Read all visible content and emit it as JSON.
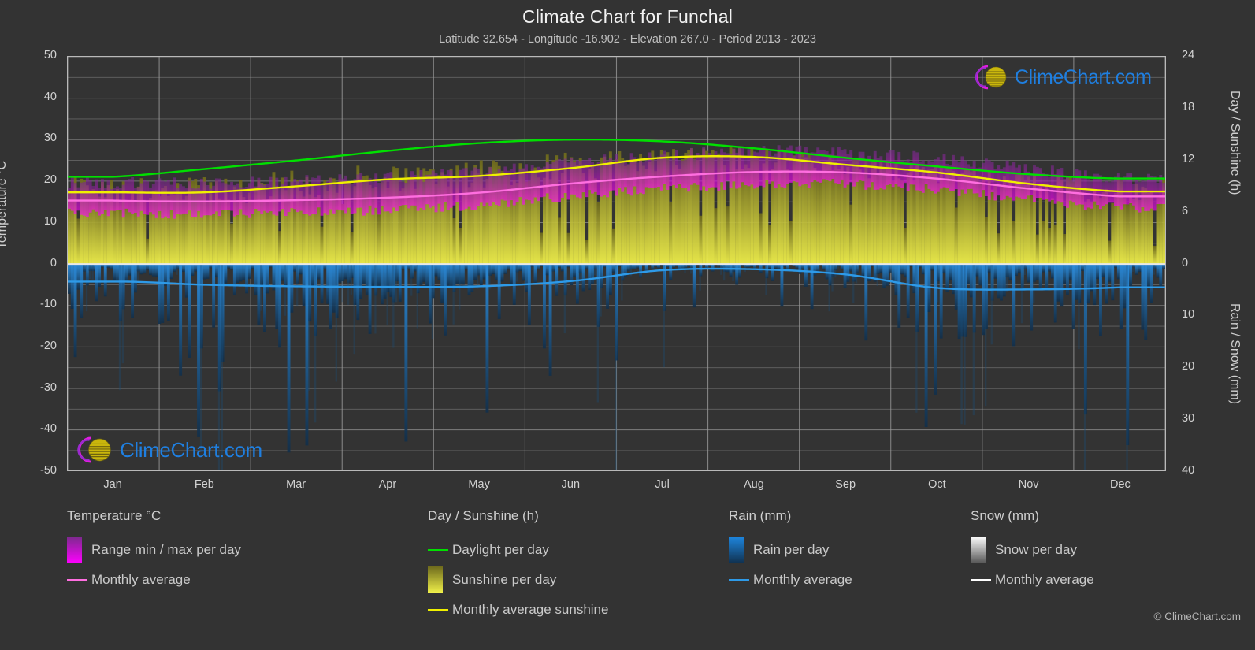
{
  "header": {
    "title": "Climate Chart for Funchal",
    "subtitle": "Latitude 32.654 - Longitude -16.902 - Elevation 267.0 - Period 2013 - 2023"
  },
  "logo": {
    "text": "ClimeChart.com",
    "mark_name": "climechart-logo-icon"
  },
  "copyright": "© ClimeChart.com",
  "axes": {
    "left_title": "Temperature °C",
    "right_top_title": "Day / Sunshine (h)",
    "right_bottom_title": "Rain / Snow (mm)",
    "left_ticks": [
      "50",
      "40",
      "30",
      "20",
      "10",
      "0",
      "-10",
      "-20",
      "-30",
      "-40",
      "-50"
    ],
    "right_ticks": [
      "24",
      "18",
      "12",
      "6",
      "0",
      "10",
      "20",
      "30",
      "40"
    ],
    "months": [
      "Jan",
      "Feb",
      "Mar",
      "Apr",
      "May",
      "Jun",
      "Jul",
      "Aug",
      "Sep",
      "Oct",
      "Nov",
      "Dec"
    ]
  },
  "colors": {
    "background": "#333333",
    "grid": "#7d7d7d",
    "frame": "#b9b9b9",
    "temp_range_top": "#7b2a8c",
    "temp_range_bottom": "#ff00ff",
    "temp_avg_line": "#ff6ee0",
    "daylight_line": "#00e000",
    "sunshine_fill_top": "#6e6a1c",
    "sunshine_fill_bottom": "#f2f24a",
    "sunshine_avg_line": "#f0f000",
    "rain_fill_top": "#1e87e0",
    "rain_fill_bottom": "#10304e",
    "rain_avg_line": "#2e9ae8",
    "snow_fill_top": "#ffffff",
    "snow_fill_bottom": "#555555",
    "snow_avg_line": "#ffffff"
  },
  "legend": {
    "temperature": {
      "title": "Temperature °C",
      "items": [
        {
          "label": "Range min / max per day",
          "swatch": "gradient",
          "color_top": "#7b2a8c",
          "color_bottom": "#ff00ff"
        },
        {
          "label": "Monthly average",
          "swatch": "line",
          "color": "#ff6ee0"
        }
      ]
    },
    "day_sunshine": {
      "title": "Day / Sunshine (h)",
      "items": [
        {
          "label": "Daylight per day",
          "swatch": "line",
          "color": "#00e000"
        },
        {
          "label": "Sunshine per day",
          "swatch": "gradient",
          "color_top": "#6e6a1c",
          "color_bottom": "#f2f24a"
        },
        {
          "label": "Monthly average sunshine",
          "swatch": "line",
          "color": "#f0f000"
        }
      ]
    },
    "rain": {
      "title": "Rain (mm)",
      "items": [
        {
          "label": "Rain per day",
          "swatch": "gradient",
          "color_top": "#1e87e0",
          "color_bottom": "#10304e"
        },
        {
          "label": "Monthly average",
          "swatch": "line",
          "color": "#2e9ae8"
        }
      ]
    },
    "snow": {
      "title": "Snow (mm)",
      "items": [
        {
          "label": "Snow per day",
          "swatch": "gradient",
          "color_top": "#ffffff",
          "color_bottom": "#555555"
        },
        {
          "label": "Monthly average",
          "swatch": "line",
          "color": "#ffffff"
        }
      ]
    }
  },
  "chart_data": {
    "type": "line",
    "title": "Climate Chart for Funchal",
    "subtitle": "Latitude 32.654 - Longitude -16.902 - Elevation 267.0 - Period 2013 - 2023",
    "xlabel": "",
    "ylabel": "Temperature °C",
    "ylabel_right_top": "Day / Sunshine (h)",
    "ylabel_right_bottom": "Rain / Snow (mm)",
    "ylim": [
      -50,
      50
    ],
    "ylim_right_sunshine": [
      0,
      24
    ],
    "ylim_right_rain": [
      0,
      40
    ],
    "grid": true,
    "legend_position": "below-chart",
    "categories": [
      "Jan",
      "Feb",
      "Mar",
      "Apr",
      "May",
      "Jun",
      "Jul",
      "Aug",
      "Sep",
      "Oct",
      "Nov",
      "Dec"
    ],
    "series": [
      {
        "name": "Monthly average temperature",
        "unit": "°C",
        "axis": "left",
        "color": "#ff6ee0",
        "values": [
          15.3,
          15.1,
          15.4,
          16.0,
          17.2,
          19.4,
          21.1,
          22.2,
          22.1,
          20.6,
          18.2,
          16.3
        ]
      },
      {
        "name": "Daily temperature range max",
        "unit": "°C",
        "axis": "left",
        "color": "#7b2a8c",
        "values": [
          19.6,
          19.4,
          20.0,
          20.8,
          22.1,
          24.3,
          26.1,
          27.2,
          26.9,
          25.4,
          22.9,
          20.7
        ]
      },
      {
        "name": "Daily temperature range min",
        "unit": "°C",
        "axis": "left",
        "color": "#ff00ff",
        "values": [
          12.4,
          12.1,
          12.4,
          13.1,
          14.3,
          16.4,
          18.1,
          19.2,
          19.3,
          17.9,
          15.6,
          13.6
        ]
      },
      {
        "name": "Daylight per day",
        "unit": "h",
        "axis": "right_top",
        "color": "#00e000",
        "values": [
          10.1,
          11.0,
          12.0,
          13.1,
          14.0,
          14.4,
          14.2,
          13.4,
          12.3,
          11.3,
          10.4,
          9.9
        ]
      },
      {
        "name": "Monthly average sunshine",
        "unit": "h",
        "axis": "right_top",
        "color": "#f0f000",
        "values": [
          8.3,
          8.3,
          9.0,
          9.8,
          10.2,
          11.1,
          12.3,
          12.4,
          11.5,
          10.6,
          9.3,
          8.4
        ]
      },
      {
        "name": "Monthly average rain",
        "unit": "mm",
        "axis": "right_bottom",
        "color": "#2e9ae8",
        "values": [
          3.4,
          4.0,
          4.3,
          4.4,
          4.3,
          3.3,
          1.2,
          1.0,
          2.0,
          4.6,
          4.9,
          4.5
        ]
      },
      {
        "name": "Monthly average snow",
        "unit": "mm",
        "axis": "right_bottom",
        "color": "#ffffff",
        "values": [
          0,
          0,
          0,
          0,
          0,
          0,
          0,
          0,
          0,
          0,
          0,
          0
        ]
      }
    ]
  }
}
